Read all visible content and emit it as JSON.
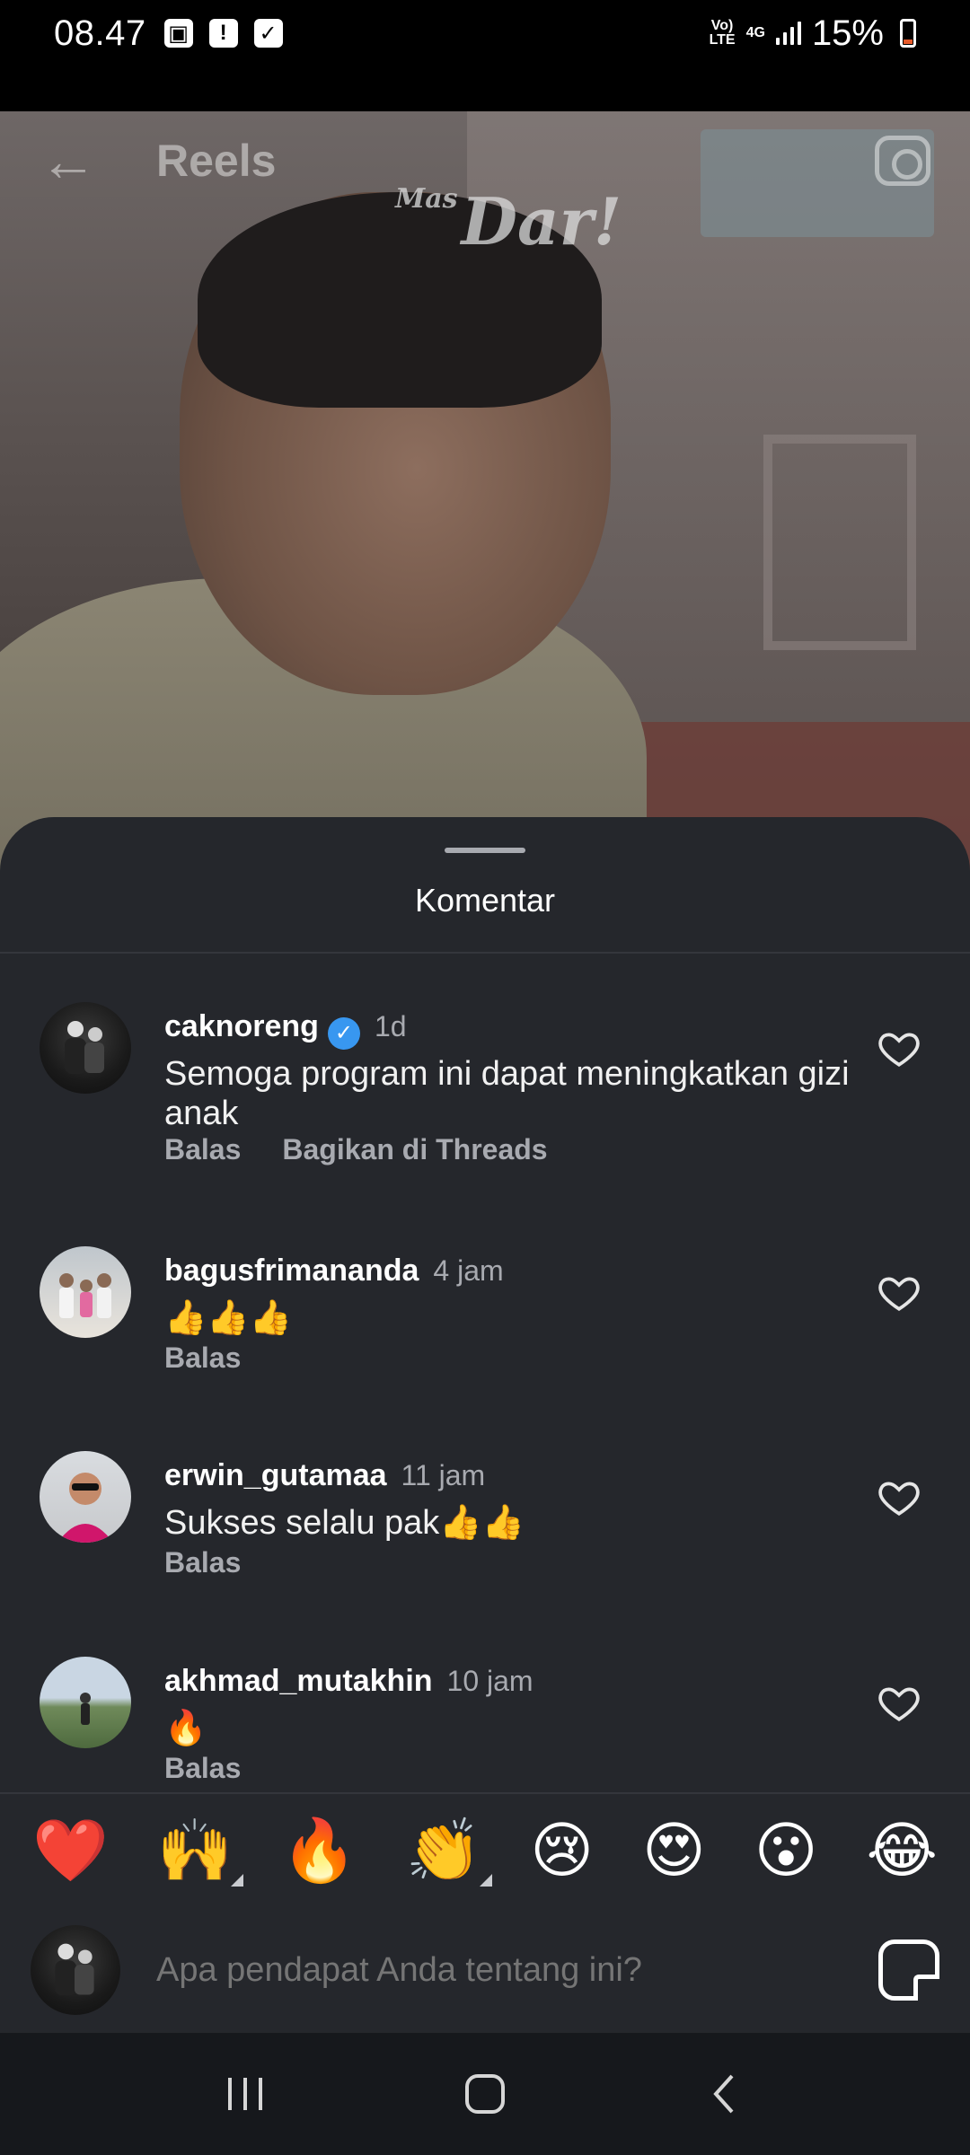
{
  "status_bar": {
    "time": "08.47",
    "network": "4G",
    "volte": "VoLTE",
    "battery": "15%"
  },
  "video": {
    "header_title": "Reels",
    "watermark_prefix": "Mas",
    "watermark_main": "Dar!"
  },
  "sheet": {
    "title": "Komentar"
  },
  "comments": [
    {
      "user": "caknoreng",
      "verified": true,
      "time": "1d",
      "text": "Semoga program ini dapat meningkatkan gizi anak",
      "reply_label": "Balas",
      "share_label": "Bagikan di Threads"
    },
    {
      "user": "bagusfrimananda",
      "time": "4 jam",
      "text": "👍👍👍",
      "reply_label": "Balas"
    },
    {
      "user": "erwin_gutamaa",
      "time": "11 jam",
      "text": "Sukses selalu pak👍👍",
      "reply_label": "Balas"
    },
    {
      "user": "akhmad_mutakhin",
      "time": "10 jam",
      "text": "🔥",
      "reply_label": "Balas"
    }
  ],
  "reactions": [
    "❤️",
    "🙌",
    "🔥",
    "👏",
    "😢",
    "😍",
    "😮",
    "😂"
  ],
  "composer": {
    "placeholder": "Apa pendapat Anda tentang ini?"
  },
  "colors": {
    "sheet_bg": "#25272c",
    "muted_text": "#a8aab0",
    "verified_blue": "#3897f0"
  }
}
